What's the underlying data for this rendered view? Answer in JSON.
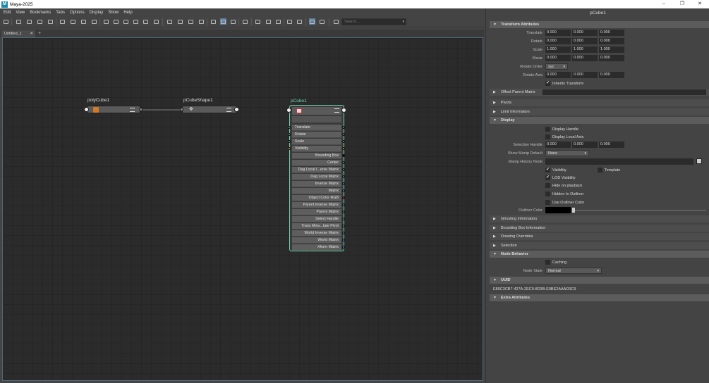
{
  "window": {
    "title": "Maya-2025",
    "logo": "M",
    "min": "–",
    "max": "❐",
    "close": "✕"
  },
  "menu": [
    "Edit",
    "View",
    "Bookmarks",
    "Tabs",
    "Options",
    "Display",
    "Show",
    "Help"
  ],
  "search": {
    "placeholder": "Search...",
    "dropdown": "▾"
  },
  "tabs": [
    {
      "label": "Untitled_1",
      "close": "✕"
    }
  ],
  "tab_plus": "+",
  "nodes": {
    "polyCube1": {
      "title": "polyCube1",
      "icon": "cube-icon"
    },
    "pCubeShape1": {
      "title": "pCubeShape1",
      "icon": "move-icon"
    },
    "pCube1": {
      "title": "pCube1",
      "icon": "transform-icon"
    }
  },
  "pcube_attrs": [
    {
      "label": "Translate",
      "align": "left",
      "in": true,
      "color": "#5aa88a"
    },
    {
      "label": "Rotate",
      "align": "left",
      "in": true,
      "color": "#5aa88a"
    },
    {
      "label": "Scale",
      "align": "left",
      "in": true,
      "color": "#5aa88a"
    },
    {
      "label": "Visibility",
      "align": "left",
      "in": true,
      "color": "#d4b040"
    },
    {
      "label": "Bounding Box",
      "align": "right",
      "in": false,
      "color": "#111111"
    },
    {
      "label": "Center",
      "align": "right",
      "in": false,
      "color": "#5aa88a"
    },
    {
      "label": "Dag Local I...erse Matrix",
      "align": "right",
      "in": false,
      "color": "#4a90b8"
    },
    {
      "label": "Dag Local Matrix",
      "align": "right",
      "in": false,
      "color": "#4a90b8"
    },
    {
      "label": "Inverse Matrix",
      "align": "right",
      "in": false,
      "color": "#4a90b8"
    },
    {
      "label": "Matrix",
      "align": "right",
      "in": false,
      "color": "#4a90b8"
    },
    {
      "label": "Object Color RGB",
      "align": "right",
      "in": false,
      "color": "#c02020"
    },
    {
      "label": "Parent Inverse Matrix",
      "align": "right",
      "in": false,
      "color": "#4a90b8"
    },
    {
      "label": "Parent Matrix",
      "align": "right",
      "in": false,
      "color": "#4a90b8"
    },
    {
      "label": "Select Handle",
      "align": "right",
      "in": false,
      "color": "#5aa88a"
    },
    {
      "label": "Trans Minu...tate Pivot",
      "align": "right",
      "in": false,
      "color": "#5aa88a"
    },
    {
      "label": "World Inverse Matrix",
      "align": "right",
      "in": false,
      "color": "#4a90b8"
    },
    {
      "label": "World Matrix",
      "align": "right",
      "in": false,
      "color": "#4a90b8"
    },
    {
      "label": "Xform Matrix",
      "align": "right",
      "in": false,
      "color": "#4a90b8"
    }
  ],
  "panel": {
    "title": "pCube1",
    "transform": {
      "header": "Transform Attributes",
      "translate": {
        "label": "Translate",
        "values": [
          "0.000",
          "0.000",
          "0.000"
        ]
      },
      "rotate": {
        "label": "Rotate",
        "values": [
          "0.000",
          "0.000",
          "0.000"
        ]
      },
      "scale": {
        "label": "Scale",
        "values": [
          "1.000",
          "1.000",
          "1.000"
        ]
      },
      "shear": {
        "label": "Shear",
        "values": [
          "0.000",
          "0.000",
          "0.000"
        ]
      },
      "rotate_order": {
        "label": "Rotate Order",
        "value": "xyz"
      },
      "rotate_axis": {
        "label": "Rotate Axis",
        "values": [
          "0.000",
          "0.000",
          "0.000"
        ]
      },
      "inherits": {
        "label": "Inherits Transform",
        "checked": "✔"
      }
    },
    "offset": {
      "header": "Offset Parent Matrix"
    },
    "pivots": "Pivots",
    "limit": "Limit Information",
    "display": {
      "header": "Display",
      "display_handle": "Display Handle",
      "display_local_axis": "Display Local Axis",
      "selection_handle": {
        "label": "Selection Handle",
        "values": [
          "0.000",
          "0.000",
          "0.000"
        ]
      },
      "show_manip": {
        "label": "Show Manip Default",
        "value": "None"
      },
      "manip_history": {
        "label": "Manip History Node"
      },
      "visibility": "Visibility",
      "template": "Template",
      "lod": "LOD Visibility",
      "hide_playback": "Hide on playback",
      "hidden_outliner": "Hidden In Outliner",
      "use_outliner": "Use Outliner Color",
      "outliner_color": {
        "label": "Outliner Color"
      },
      "check": "✔"
    },
    "ghosting": "Ghosting Information",
    "bbox": "Bounding Box Information",
    "drawing": "Drawing Overrides",
    "selection": "Selection",
    "node_behavior": {
      "header": "Node Behavior",
      "caching": "Caching",
      "node_state": {
        "label": "Node State",
        "value": "Normal"
      }
    },
    "uuid": {
      "header": "UUID",
      "value": "E80C3CB7-427A-2EC9-8D3B-E0BE2AAAD3C9"
    },
    "extra": "Extra Attributes",
    "dropdown": "▾"
  }
}
